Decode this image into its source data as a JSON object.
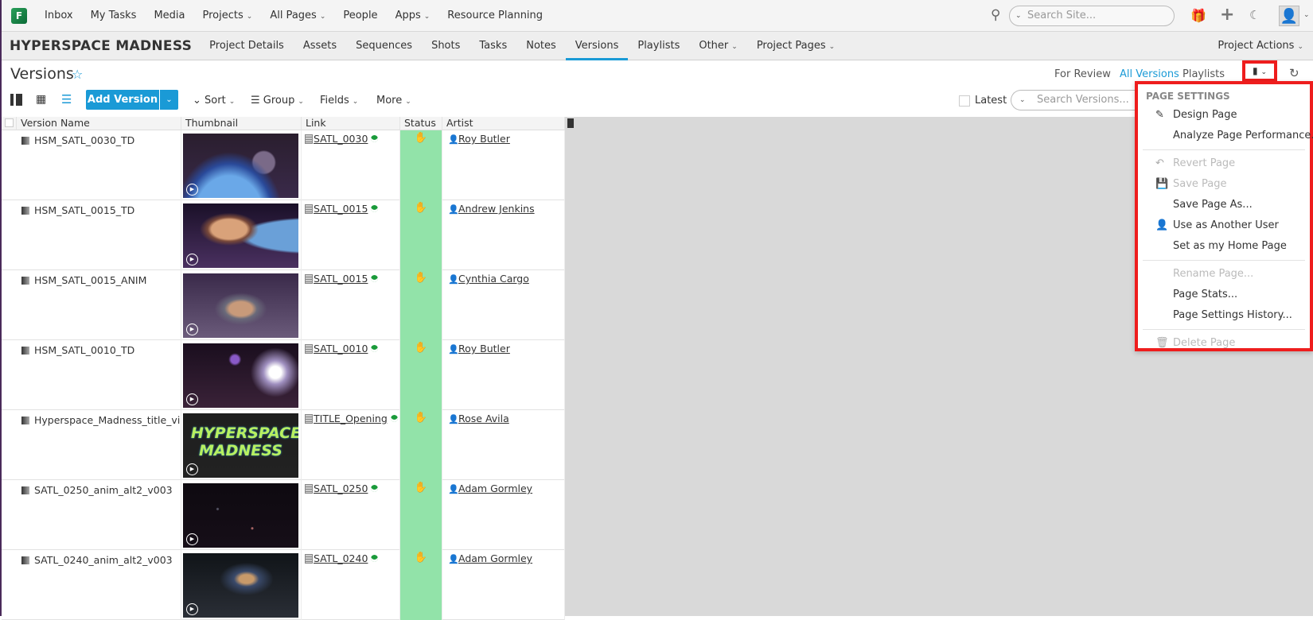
{
  "topnav": {
    "items": [
      {
        "label": "Inbox"
      },
      {
        "label": "My Tasks"
      },
      {
        "label": "Media"
      },
      {
        "label": "Projects",
        "dropdown": true
      },
      {
        "label": "All Pages",
        "dropdown": true
      },
      {
        "label": "People"
      },
      {
        "label": "Apps",
        "dropdown": true
      },
      {
        "label": "Resource Planning"
      }
    ],
    "search_placeholder": "Search Site...",
    "logo": "F"
  },
  "project": {
    "title": "HYPERSPACE MADNESS",
    "tabs": [
      {
        "label": "Project Details"
      },
      {
        "label": "Assets"
      },
      {
        "label": "Sequences"
      },
      {
        "label": "Shots"
      },
      {
        "label": "Tasks"
      },
      {
        "label": "Notes"
      },
      {
        "label": "Versions",
        "active": true
      },
      {
        "label": "Playlists"
      },
      {
        "label": "Other",
        "dropdown": true
      },
      {
        "label": "Project Pages",
        "dropdown": true
      }
    ],
    "actions": "Project Actions"
  },
  "page": {
    "title": "Versions",
    "views": [
      "For Review",
      "All Versions",
      "Playlists"
    ],
    "active_view": "All Versions"
  },
  "toolbar": {
    "add": "Add Version",
    "sort": "Sort",
    "group": "Group",
    "fields": "Fields",
    "more": "More",
    "latest": "Latest",
    "search_placeholder": "Search Versions..."
  },
  "table": {
    "columns": [
      "Version Name",
      "Thumbnail",
      "Link",
      "Status",
      "Artist"
    ],
    "rows": [
      {
        "name": "HSM_SATL_0030_TD",
        "link": "SATL_0030",
        "status": "hand-icon",
        "artist": "Roy Butler",
        "thumb": "earth"
      },
      {
        "name": "HSM_SATL_0015_TD",
        "link": "SATL_0015",
        "status": "hand-icon",
        "artist": "Andrew Jenkins",
        "thumb": "char"
      },
      {
        "name": "HSM_SATL_0015_ANIM",
        "link": "SATL_0015",
        "status": "hand-icon",
        "artist": "Cynthia Cargo",
        "thumb": "char2"
      },
      {
        "name": "HSM_SATL_0010_TD",
        "link": "SATL_0010",
        "status": "hand-icon",
        "artist": "Roy Butler",
        "thumb": "space"
      },
      {
        "name": "Hyperspace_Madness_title_vi...",
        "link": "TITLE_Opening",
        "status": "hand-icon",
        "artist": "Rose Avila",
        "thumb": "title"
      },
      {
        "name": "SATL_0250_anim_alt2_v003",
        "link": "SATL_0250",
        "status": "hand-icon",
        "artist": "Adam Gormley",
        "thumb": "stars",
        "inactive_user": true
      },
      {
        "name": "SATL_0240_anim_alt2_v003",
        "link": "SATL_0240",
        "status": "hand-icon",
        "artist": "Adam Gormley",
        "thumb": "char3",
        "inactive_user": true
      }
    ]
  },
  "thumb_title_text": "HYPERSPACE MADNESS",
  "menu": {
    "header": "PAGE SETTINGS",
    "groups": [
      [
        {
          "label": "Design Page",
          "icon": "pencil-icon"
        },
        {
          "label": "Analyze Page Performance..."
        }
      ],
      [
        {
          "label": "Revert Page",
          "icon": "undo-icon",
          "disabled": true
        },
        {
          "label": "Save Page",
          "icon": "save-icon",
          "disabled": true
        },
        {
          "label": "Save Page As..."
        },
        {
          "label": "Use as Another User",
          "icon": "user-icon"
        },
        {
          "label": "Set as my Home Page"
        }
      ],
      [
        {
          "label": "Rename Page...",
          "disabled": true
        },
        {
          "label": "Page Stats..."
        },
        {
          "label": "Page Settings History..."
        }
      ],
      [
        {
          "label": "Delete Page",
          "icon": "trash-icon",
          "disabled": true
        }
      ]
    ]
  },
  "colors": {
    "accent": "#1a9ad6",
    "status_green": "#92e3a9",
    "highlight": "#ee1d1d"
  }
}
